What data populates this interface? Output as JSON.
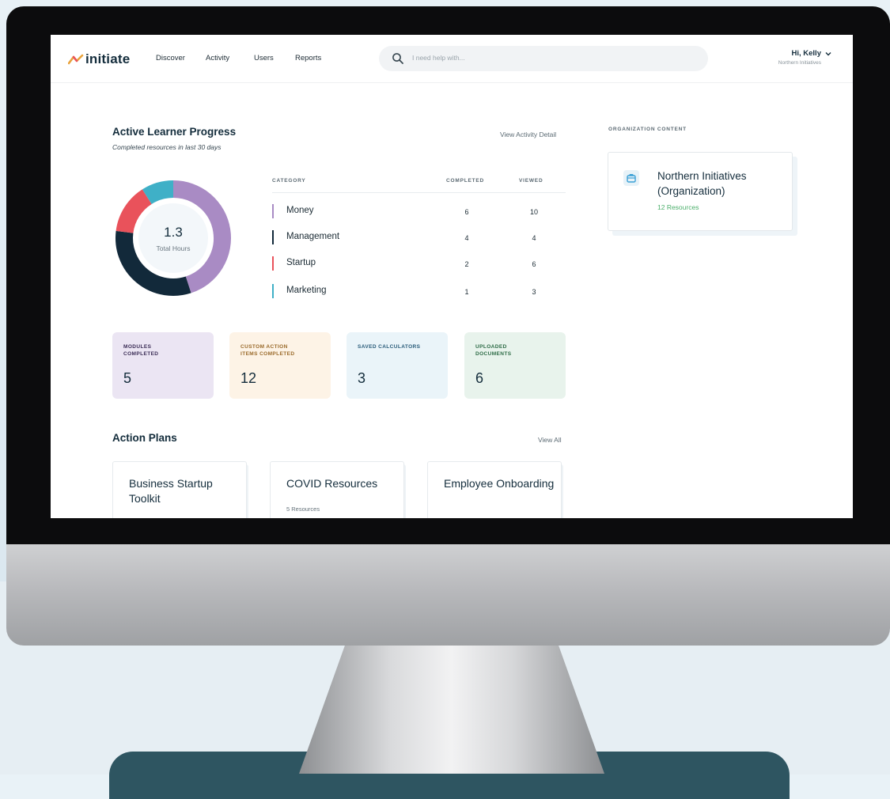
{
  "nav": {
    "logo_text": "initiate",
    "links": [
      "Discover",
      "Activity",
      "Users",
      "Reports"
    ],
    "search_placeholder": "I need help with...",
    "greeting": "Hi, Kelly",
    "org": "Northern Initiatives"
  },
  "progress": {
    "title": "Active Learner Progress",
    "subtitle": "Completed resources in last 30 days",
    "link": "View Activity Detail",
    "total_value": "1.3",
    "total_label": "Total Hours",
    "headers": {
      "category": "CATEGORY",
      "completed": "COMPLETED",
      "viewed": "VIEWED"
    },
    "rows": [
      {
        "label": "Money",
        "completed": "6",
        "viewed": "10",
        "color": "#a98bc4"
      },
      {
        "label": "Management",
        "completed": "4",
        "viewed": "4",
        "color": "#12293a"
      },
      {
        "label": "Startup",
        "completed": "2",
        "viewed": "6",
        "color": "#e9525b"
      },
      {
        "label": "Marketing",
        "completed": "1",
        "viewed": "3",
        "color": "#3fb0c7"
      }
    ],
    "donut": [
      {
        "name": "Money",
        "share": 0.45,
        "color": "#a98bc4"
      },
      {
        "name": "Management",
        "share": 0.32,
        "color": "#12293a"
      },
      {
        "name": "Startup",
        "share": 0.14,
        "color": "#e9525b"
      },
      {
        "name": "Marketing",
        "share": 0.09,
        "color": "#3fb0c7"
      }
    ]
  },
  "stats": [
    {
      "label": "MODULES\nCOMPLETED",
      "value": "5",
      "bg": "#ebe5f3",
      "fg": "#3a2c55"
    },
    {
      "label": "CUSTOM ACTION\nITEMS COMPLETED",
      "value": "12",
      "bg": "#fdf3e6",
      "fg": "#9a6a2a"
    },
    {
      "label": "SAVED CALCULATORS",
      "value": "3",
      "bg": "#eaf4f9",
      "fg": "#2a5c7a"
    },
    {
      "label": "UPLOADED\nDOCUMENTS",
      "value": "6",
      "bg": "#e8f3ec",
      "fg": "#2c6b45"
    }
  ],
  "plans": {
    "title": "Action Plans",
    "link": "View All",
    "cards": [
      {
        "title": "Business Startup Toolkit",
        "meta": ""
      },
      {
        "title": "COVID Resources",
        "meta": "5 Resources"
      },
      {
        "title": "Employee Onboarding",
        "meta": ""
      }
    ]
  },
  "org_content": {
    "heading": "ORGANIZATION CONTENT",
    "name": "Northern Initiatives (Organization)",
    "resources": "12 Resources"
  }
}
